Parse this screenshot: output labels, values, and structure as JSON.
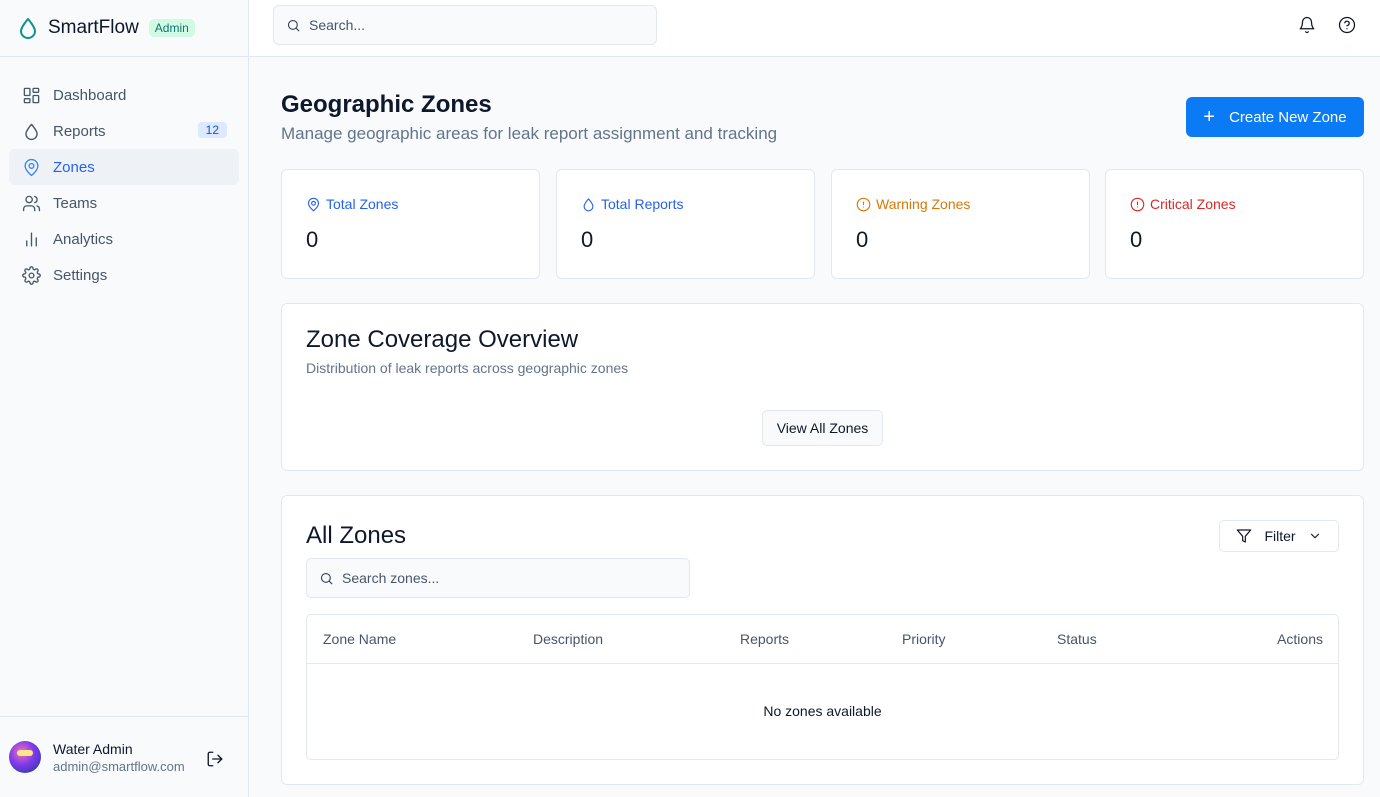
{
  "brand": {
    "name": "SmartFlow",
    "badge": "Admin",
    "accent": "#0d9488"
  },
  "topbar": {
    "search_placeholder": "Search..."
  },
  "sidebar": {
    "items": [
      {
        "label": "Dashboard",
        "icon": "dashboard-icon"
      },
      {
        "label": "Reports",
        "icon": "droplet-icon",
        "count": "12"
      },
      {
        "label": "Zones",
        "icon": "map-pin-icon",
        "active": true
      },
      {
        "label": "Teams",
        "icon": "users-icon"
      },
      {
        "label": "Analytics",
        "icon": "bar-chart-icon"
      },
      {
        "label": "Settings",
        "icon": "gear-icon"
      }
    ]
  },
  "user": {
    "name": "Water Admin",
    "email": "admin@smartflow.com"
  },
  "header": {
    "title": "Geographic Zones",
    "subtitle": "Manage geographic areas for leak report assignment and tracking",
    "create_label": "Create New Zone"
  },
  "stats": [
    {
      "label": "Total Zones",
      "value": "0",
      "color": "#2563eb",
      "icon": "map-pin-icon"
    },
    {
      "label": "Total Reports",
      "value": "0",
      "color": "#2563eb",
      "icon": "droplet-icon"
    },
    {
      "label": "Warning Zones",
      "value": "0",
      "color": "#d97706",
      "icon": "alert-circle-icon"
    },
    {
      "label": "Critical Zones",
      "value": "0",
      "color": "#dc2626",
      "icon": "alert-circle-icon"
    }
  ],
  "coverage": {
    "title": "Zone Coverage Overview",
    "subtitle": "Distribution of leak reports across geographic zones",
    "view_all_label": "View All Zones"
  },
  "zones": {
    "title": "All Zones",
    "filter_label": "Filter",
    "search_placeholder": "Search zones...",
    "columns": [
      "Zone Name",
      "Description",
      "Reports",
      "Priority",
      "Status",
      "Actions"
    ],
    "empty_text": "No zones available"
  }
}
